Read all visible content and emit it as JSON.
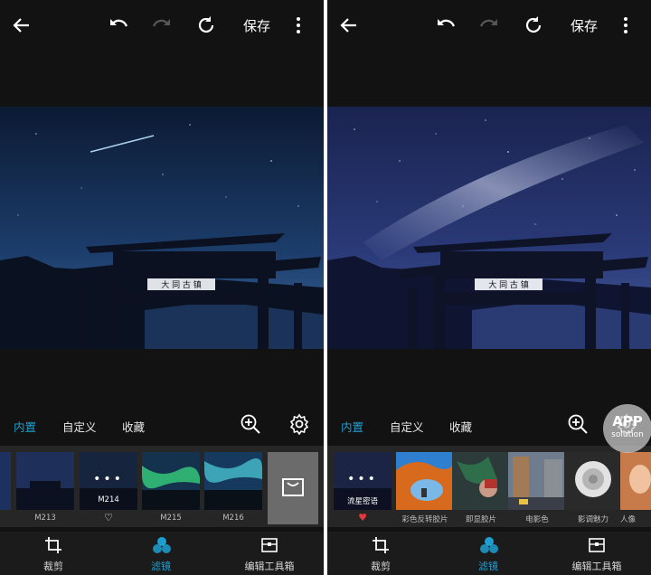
{
  "left_screen": {
    "toolbar": {
      "save_label": "保存"
    },
    "tabs": [
      {
        "label": "内置",
        "active": true
      },
      {
        "label": "自定义",
        "active": false
      },
      {
        "label": "收藏",
        "active": false
      }
    ],
    "filters": [
      {
        "label": "M213"
      },
      {
        "label": "M214",
        "selected": true,
        "favorite": false
      },
      {
        "label": "M215"
      },
      {
        "label": "M216"
      }
    ],
    "bottom_nav": [
      {
        "label": "裁剪",
        "icon": "crop-icon",
        "active": false
      },
      {
        "label": "滤镜",
        "icon": "filter-icon",
        "active": true
      },
      {
        "label": "编辑工具箱",
        "icon": "toolbox-icon",
        "active": false
      }
    ],
    "store_icon": "shopping-bag-icon"
  },
  "right_screen": {
    "toolbar": {
      "save_label": "保存"
    },
    "tabs": [
      {
        "label": "内置",
        "active": true
      },
      {
        "label": "自定义",
        "active": false
      },
      {
        "label": "收藏",
        "active": false
      }
    ],
    "filters": [
      {
        "label": "流星密语",
        "selected": true,
        "favorite": true
      },
      {
        "label": "彩色反转胶片"
      },
      {
        "label": "即显胶片"
      },
      {
        "label": "电影色"
      },
      {
        "label": "影调魅力"
      },
      {
        "label": "人像"
      }
    ],
    "bottom_nav": [
      {
        "label": "裁剪",
        "icon": "crop-icon",
        "active": false
      },
      {
        "label": "滤镜",
        "icon": "filter-icon",
        "active": true
      },
      {
        "label": "编辑工具箱",
        "icon": "toolbox-icon",
        "active": false
      }
    ]
  },
  "photo": {
    "sign_text": "大 同 古 镇"
  },
  "watermark": {
    "text": "APP",
    "sub": "solution"
  },
  "colors": {
    "accent": "#1f9fd1",
    "background": "#121212",
    "strip": "#262626",
    "favorite": "#e0393e"
  }
}
